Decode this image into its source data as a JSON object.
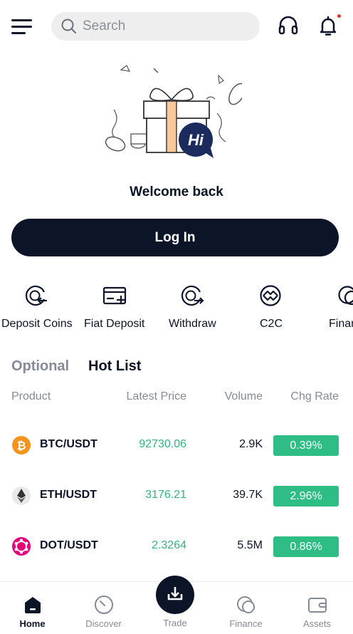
{
  "search": {
    "placeholder": "Search"
  },
  "hero": {
    "badge_text": "Hi"
  },
  "welcome": "Welcome back",
  "login_label": "Log In",
  "quick_actions": [
    {
      "label": "Deposit Coins",
      "icon": "deposit-coins-icon"
    },
    {
      "label": "Fiat Deposit",
      "icon": "fiat-deposit-icon"
    },
    {
      "label": "Withdraw",
      "icon": "withdraw-icon"
    },
    {
      "label": "C2C",
      "icon": "c2c-icon"
    },
    {
      "label": "Finar",
      "icon": "finance-icon"
    }
  ],
  "tabs": {
    "optional": "Optional",
    "hot": "Hot List"
  },
  "columns": {
    "product": "Product",
    "price": "Latest Price",
    "volume": "Volume",
    "change": "Chg Rate"
  },
  "markets": [
    {
      "pair": "BTC/USDT",
      "price": "92730.06",
      "volume": "2.9K",
      "change": "0.39%",
      "icon": "btc-icon"
    },
    {
      "pair": "ETH/USDT",
      "price": "3176.21",
      "volume": "39.7K",
      "change": "2.96%",
      "icon": "eth-icon"
    },
    {
      "pair": "DOT/USDT",
      "price": "2.3264",
      "volume": "5.5M",
      "change": "0.86%",
      "icon": "dot-icon"
    }
  ],
  "nav": [
    {
      "label": "Home",
      "icon": "home-icon",
      "active": true
    },
    {
      "label": "Discover",
      "icon": "discover-icon"
    },
    {
      "label": "Trade",
      "icon": "trade-icon"
    },
    {
      "label": "Finance",
      "icon": "finance-icon"
    },
    {
      "label": "Assets",
      "icon": "wallet-icon"
    }
  ],
  "colors": {
    "primary": "#0c1527",
    "up": "#2ebd85",
    "muted": "#858b96",
    "notify": "#e5303f",
    "btc": "#f7931a",
    "dot": "#e6007a"
  }
}
